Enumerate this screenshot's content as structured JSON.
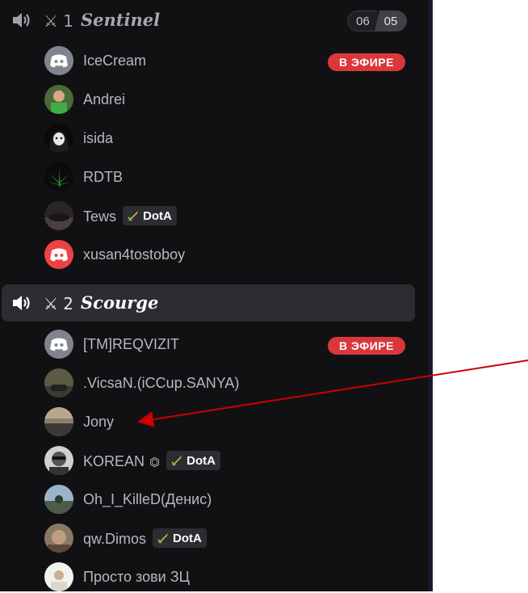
{
  "channels": [
    {
      "prefix": "⚔ 1",
      "name": "Sentinel",
      "counter_current": "06",
      "counter_max": "05",
      "members": [
        {
          "name": "IceCream",
          "avatar": "discord-default-icon",
          "avatar_color": "#5865f2",
          "live": "В ЭФИРЕ"
        },
        {
          "name": "Andrei",
          "avatar": "photo-avatar"
        },
        {
          "name": "isida",
          "avatar": "anime-girl-avatar"
        },
        {
          "name": "RDTB",
          "avatar": "leaf-avatar"
        },
        {
          "name": "Tews",
          "avatar": "photo-avatar",
          "activity": "DotA"
        },
        {
          "name": "xusan4tostoboy",
          "avatar": "discord-default-icon",
          "avatar_color": "#ed4245"
        }
      ]
    },
    {
      "prefix": "⚔ 2",
      "name": "Scourge",
      "members": [
        {
          "name": "[TM]REQVIZIT",
          "avatar": "discord-default-icon",
          "avatar_color": "#5865f2",
          "live": "В ЭФИРЕ"
        },
        {
          "name": ".VicsaN.(iCCup.SANYA)",
          "avatar": "photo-avatar"
        },
        {
          "name": "Jony",
          "avatar": "photo-avatar"
        },
        {
          "name": "KOREAN",
          "avatar": "photo-avatar",
          "badge": "hexagon-icon",
          "activity": "DotA"
        },
        {
          "name": "Oh_I_KilleD(Денис)",
          "avatar": "photo-avatar"
        },
        {
          "name": "qw.Dimos",
          "avatar": "photo-avatar",
          "activity": "DotA"
        },
        {
          "name": "Просто зови ЗЦ",
          "avatar": "photo-avatar"
        }
      ]
    }
  ],
  "colors": {
    "panel_bg": "#111113",
    "live_badge": "#da373c",
    "annotation_arrow": "#cc0000"
  }
}
